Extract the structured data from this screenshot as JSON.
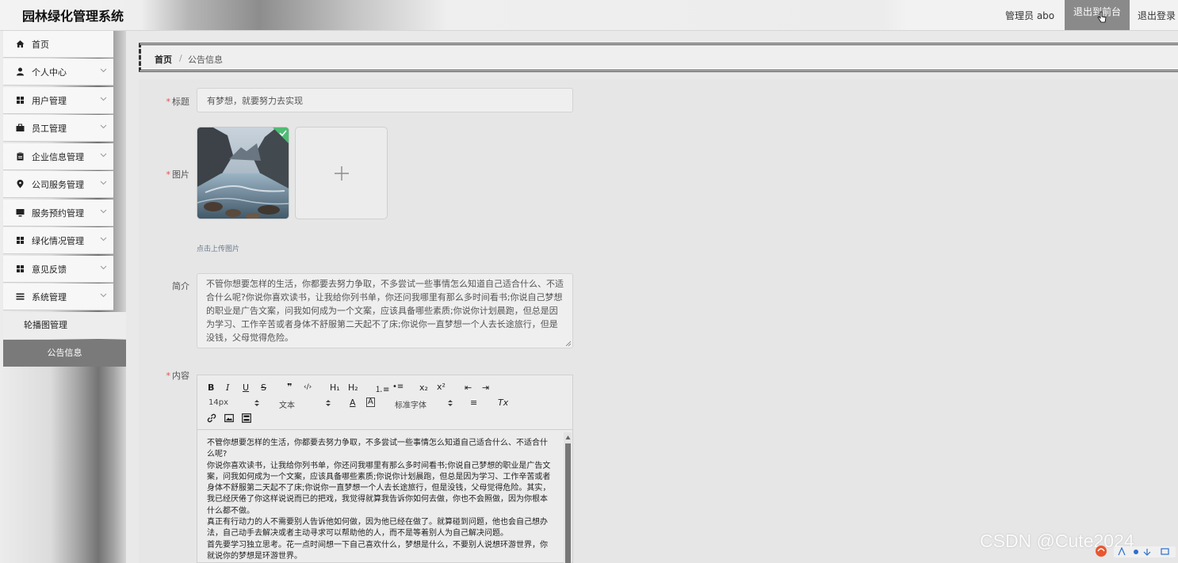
{
  "header": {
    "app_title": "园林绿化管理系统",
    "admin_label": "管理员 abo",
    "front_button": "退出到前台",
    "logout_button": "退出登录"
  },
  "sidebar": {
    "items": [
      {
        "label": "首页",
        "icon": "home-icon"
      },
      {
        "label": "个人中心",
        "icon": "user-icon"
      },
      {
        "label": "用户管理",
        "icon": "grid-icon"
      },
      {
        "label": "员工管理",
        "icon": "briefcase-icon"
      },
      {
        "label": "企业信息管理",
        "icon": "clipboard-icon"
      },
      {
        "label": "公司服务管理",
        "icon": "location-icon"
      },
      {
        "label": "服务预约管理",
        "icon": "monitor-icon"
      },
      {
        "label": "绿化情况管理",
        "icon": "grid-icon"
      },
      {
        "label": "意见反馈",
        "icon": "grid-icon"
      },
      {
        "label": "系统管理",
        "icon": "list-icon"
      }
    ],
    "sub_items": [
      {
        "label": "轮播图管理"
      },
      {
        "label": "公告信息"
      }
    ]
  },
  "breadcrumb": {
    "home": "首页",
    "separator": "/",
    "current": "公告信息"
  },
  "form": {
    "required_mark": "*",
    "title_label": "标题",
    "title_value": "有梦想，就要努力去实现",
    "image_label": "图片",
    "upload_tip": "点击上传图片",
    "intro_label": "简介",
    "intro_value": "不管你想要怎样的生活，你都要去努力争取，不多尝试一些事情怎么知道自己适合什么、不适合什么呢?你说你喜欢读书，让我给你列书单，你还问我哪里有那么多时间看书;你说自己梦想的职业是广告文案，问我如何成为一个文案，应该具备哪些素质;你说你计划晨跑，但总是因为学习、工作辛苦或者身体不舒服第二天起不了床;你说你一直梦想一个人去长途旅行，但是没钱，父母觉得危险。",
    "content_label": "内容"
  },
  "editor": {
    "toolbar": {
      "bold": "B",
      "italic": "I",
      "underline": "U",
      "strike": "S",
      "quote": "❞",
      "code": "‹/›",
      "h1": "H₁",
      "h2": "H₂",
      "ordered_list": "⒈≡",
      "bullet_list": "•≡",
      "subscript": "x₂",
      "superscript": "x²",
      "outdent": "⇤",
      "indent": "⇥",
      "font_size": "14px",
      "text_type": "文本",
      "font_color": "A",
      "bg_color": "A",
      "font_family": "标准字体",
      "align": "≡",
      "clear": "Tx"
    },
    "paragraphs": [
      "不管你想要怎样的生活，你都要去努力争取，不多尝试一些事情怎么知道自己适合什么、不适合什么呢?",
      "你说你喜欢读书，让我给你列书单，你还问我哪里有那么多时间看书;你说自己梦想的职业是广告文案，问我如何成为一个文案，应该具备哪些素质;你说你计划晨跑，但总是因为学习、工作辛苦或者身体不舒服第二天起不了床;你说你一直梦想一个人去长途旅行，但是没钱，父母觉得危险。其实，我已经厌倦了你这样说说而已的把戏，我觉得就算我告诉你如何去做，你也不会照做，因为你根本什么都不做。",
      "真正有行动力的人不需要别人告诉他如何做，因为他已经在做了。就算碰到问题，他也会自己想办法，自己动手去解决或者主动寻求可以帮助他的人，而不是等着别人为自己解决问题。",
      "首先要学习独立思考。花一点时间想一下自己喜欢什么，梦想是什么，不要别人说想环游世界，你就说你的梦想是环游世界。"
    ]
  },
  "watermark": "CSDN @Cute2024"
}
